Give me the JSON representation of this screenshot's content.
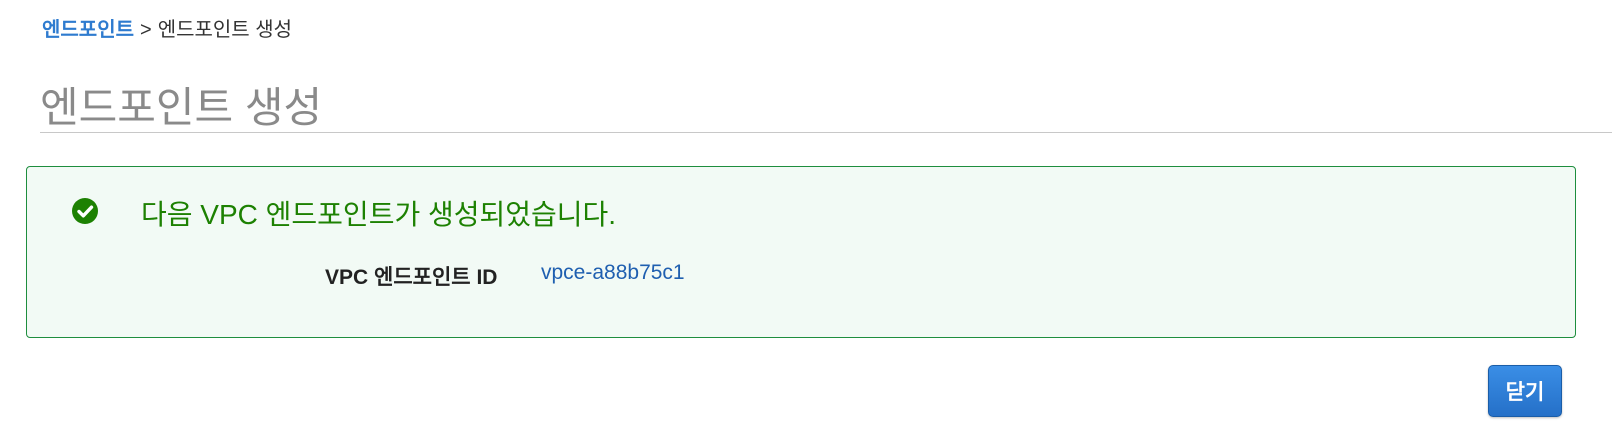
{
  "breadcrumb": {
    "link_label": "엔드포인트",
    "separator": ">",
    "current": "엔드포인트 생성"
  },
  "page": {
    "title": "엔드포인트 생성"
  },
  "success": {
    "message": "다음 VPC 엔드포인트가 생성되었습니다.",
    "icon": "check-circle-icon",
    "details": {
      "label": "VPC 엔드포인트 ID",
      "value": "vpce-a88b75c1"
    }
  },
  "actions": {
    "close_label": "닫기"
  },
  "colors": {
    "link": "#2e7bcf",
    "success_green": "#1d8102",
    "success_border": "#1e8e3e",
    "success_bg": "#f2faf5",
    "button_blue": "#2e7bcf",
    "title_gray": "#8a8a8a"
  }
}
